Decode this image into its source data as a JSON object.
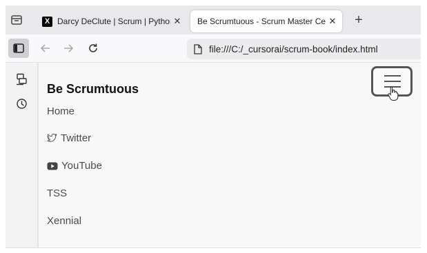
{
  "browser": {
    "tabs": [
      {
        "favicon": "X",
        "title": "Darcy DeClute | Scrum | Python",
        "close": "✕",
        "active": false
      },
      {
        "favicon": "",
        "title": "Be Scrumtuous - Scrum Master Cert",
        "close": "✕",
        "active": true
      }
    ],
    "new_tab": "+",
    "url": "file:///C:/_cursorai/scrum-book/index.html"
  },
  "sidebar_icons": [
    "sync-icon",
    "history-icon"
  ],
  "page": {
    "site_title": "Be Scrumtuous",
    "nav": [
      {
        "label": "Home",
        "icon": ""
      },
      {
        "label": "Twitter",
        "icon": "twitter-icon"
      },
      {
        "label": "YouTube",
        "icon": "youtube-icon"
      },
      {
        "label": "TSS",
        "icon": ""
      },
      {
        "label": "Xennial",
        "icon": ""
      }
    ]
  }
}
